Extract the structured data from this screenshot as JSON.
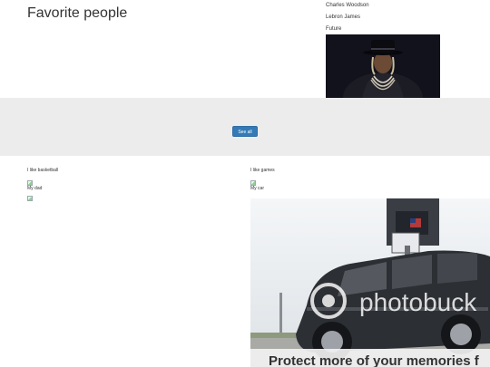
{
  "header": {
    "title": "Favorite people"
  },
  "people": [
    {
      "name": "Charles Woodson"
    },
    {
      "name": "Lebron James"
    },
    {
      "name": "Future"
    }
  ],
  "band": {
    "see_all_label": "See all"
  },
  "left_column": {
    "heading": "I like basketball",
    "caption": "My dad"
  },
  "right_column": {
    "heading": "I like games",
    "caption": "My car"
  },
  "car_photo": {
    "watermark_text": "photobucket",
    "banner_text": "Protect more of your memories for less!"
  },
  "colors": {
    "button": "#337ab7",
    "band": "#ececec"
  }
}
